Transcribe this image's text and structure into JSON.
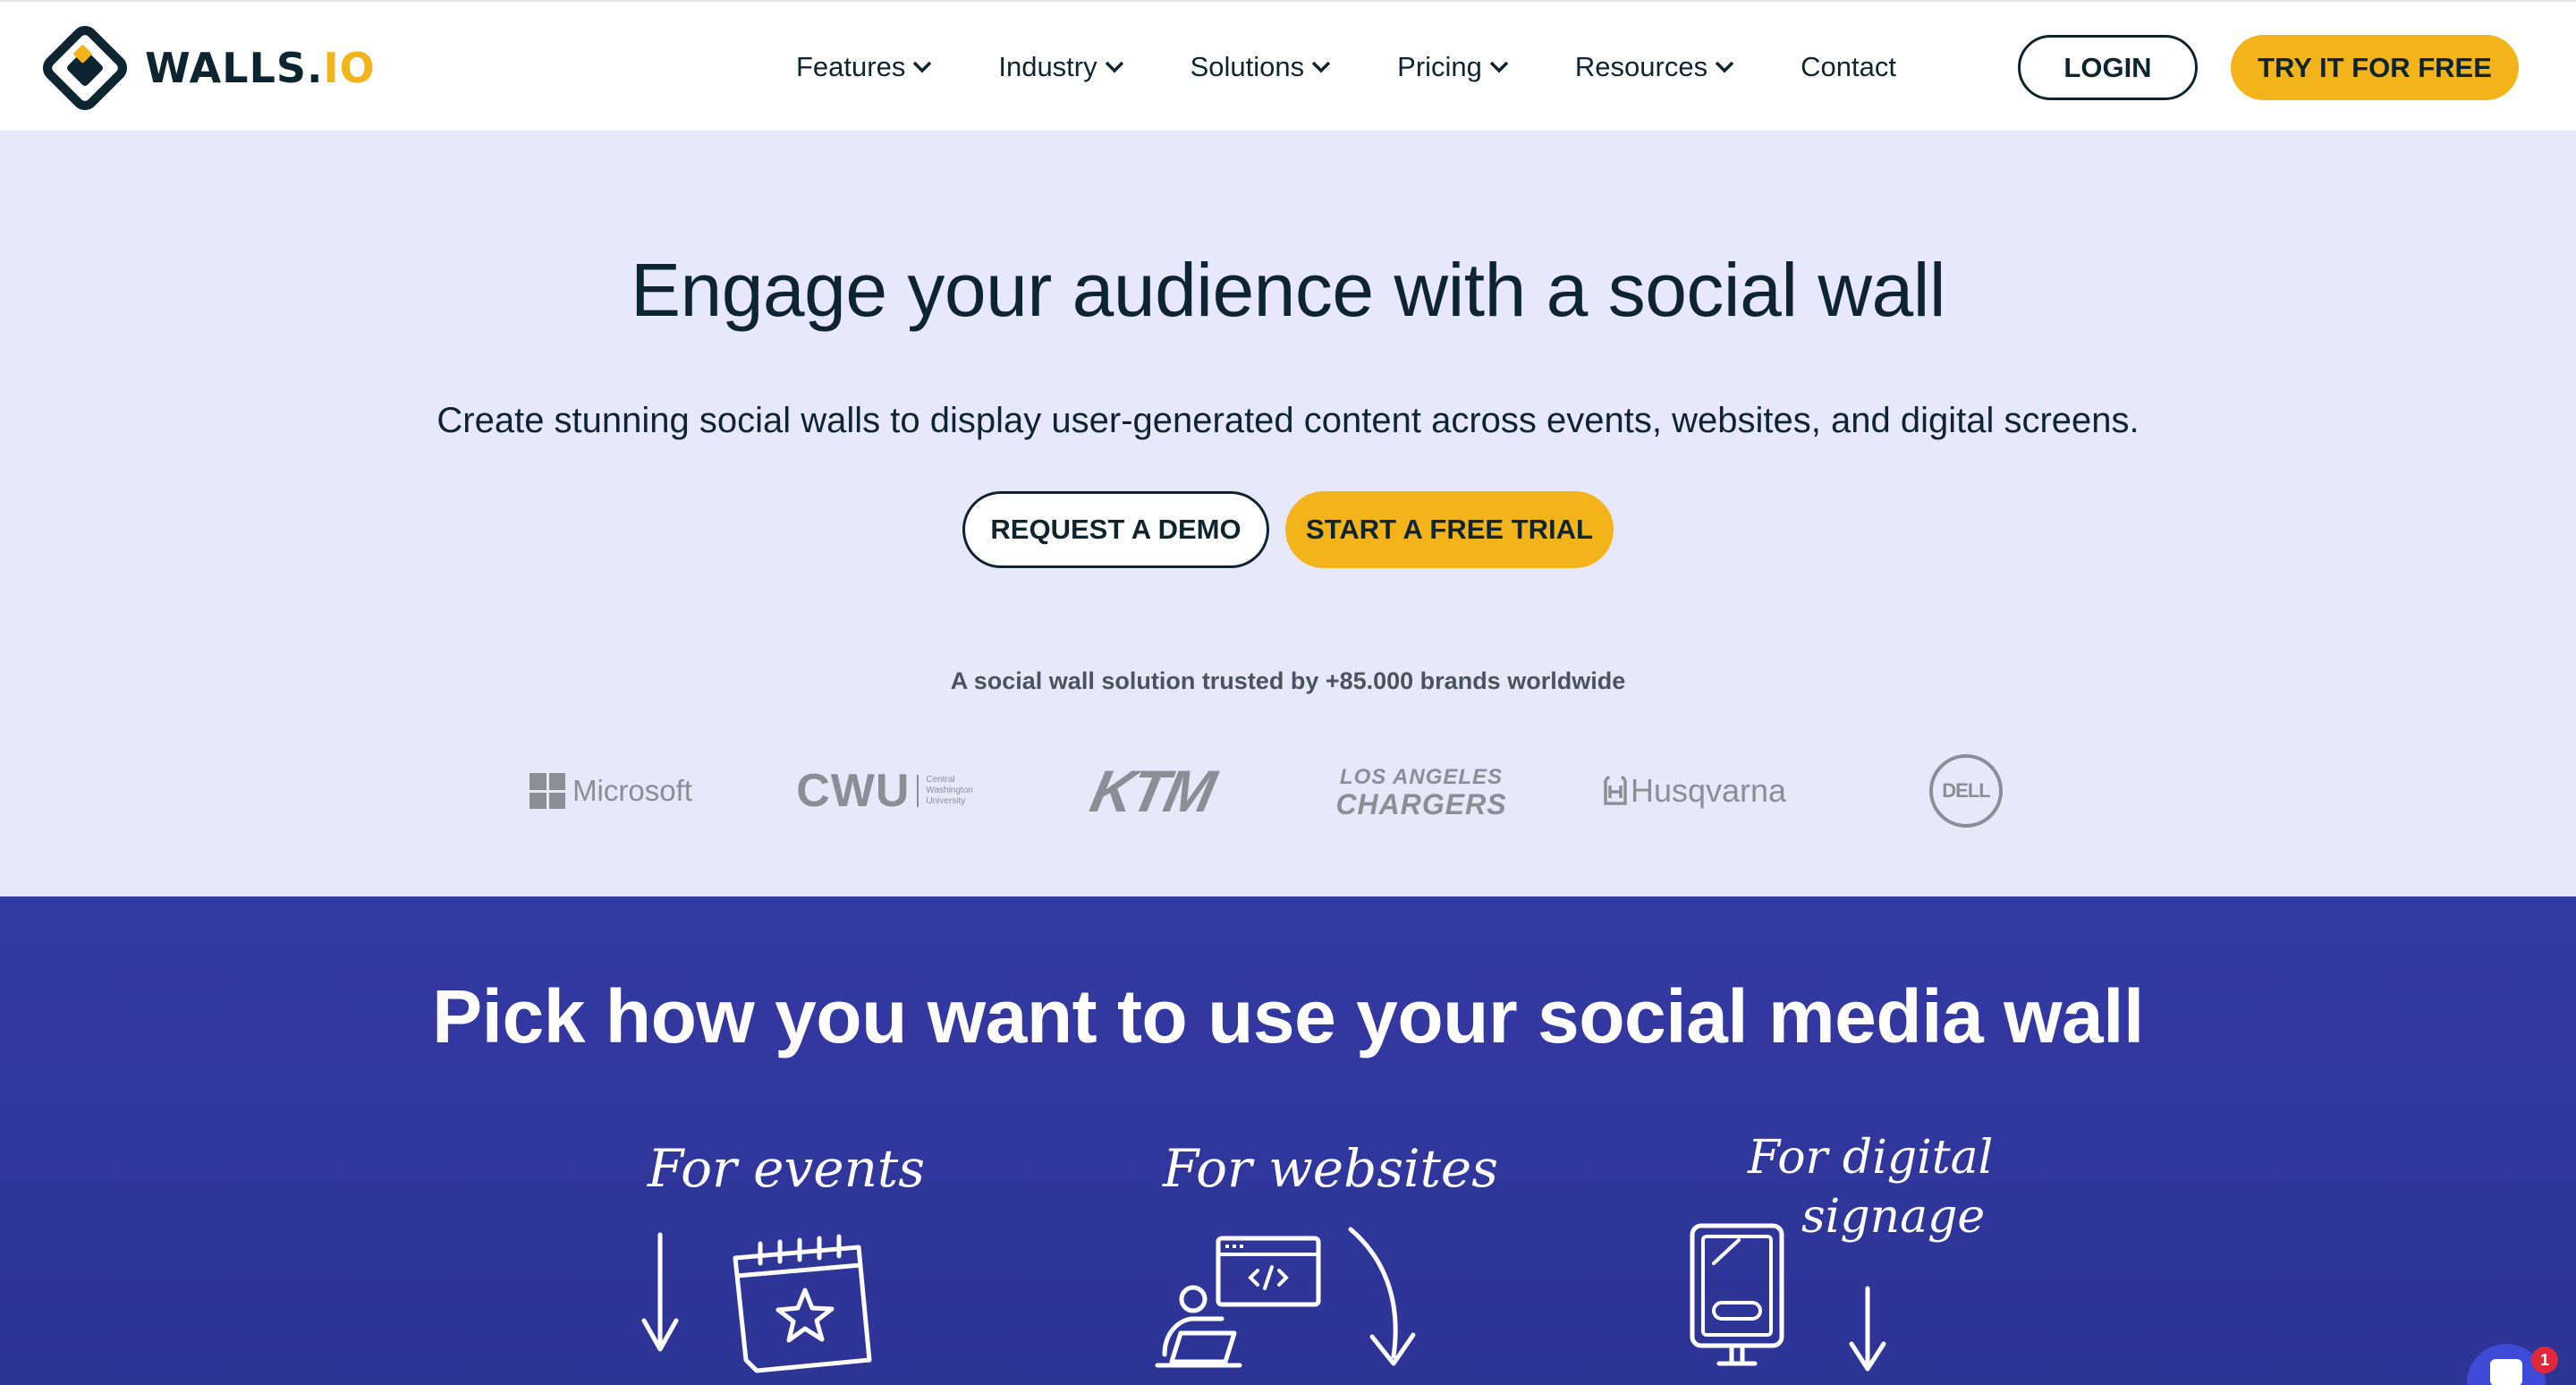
{
  "header": {
    "logo": {
      "text_main": "WALLS.",
      "text_accent": "IO"
    },
    "nav": [
      {
        "label": "Features",
        "has_dropdown": true
      },
      {
        "label": "Industry",
        "has_dropdown": true
      },
      {
        "label": "Solutions",
        "has_dropdown": true
      },
      {
        "label": "Pricing",
        "has_dropdown": true
      },
      {
        "label": "Resources",
        "has_dropdown": true
      },
      {
        "label": "Contact",
        "has_dropdown": false
      }
    ],
    "login_label": "LOGIN",
    "try_label": "TRY IT FOR FREE"
  },
  "hero": {
    "title": "Engage your audience with a social wall",
    "subtitle": "Create stunning social walls to display user-generated content across events, websites, and digital screens.",
    "demo_label": "REQUEST A DEMO",
    "trial_label": "START A FREE TRIAL",
    "trusted_text": "A social wall solution trusted by +85.000 brands worldwide",
    "brands": {
      "microsoft": "Microsoft",
      "cwu": "CWU",
      "cwu_sub": [
        "Central",
        "Washington",
        "University"
      ],
      "ktm": "KTM",
      "chargers_top": "LOS ANGELES",
      "chargers_bottom": "CHARGERS",
      "husqvarna": "Husqvarna",
      "dell": "DELL"
    }
  },
  "use_section": {
    "title": "Pick how you want to use your social media wall",
    "options": [
      {
        "label": "For events",
        "icon": "calendar-star-icon"
      },
      {
        "label": "For websites",
        "icon": "laptop-code-icon"
      },
      {
        "label_line1": "For digital",
        "label_line2": "signage",
        "icon": "digital-signage-icon"
      }
    ]
  },
  "chat": {
    "badge_count": "1"
  },
  "colors": {
    "accent_yellow": "#f3b41b",
    "navy_text": "#0d2530",
    "hero_bg": "#e8e8fb",
    "section_blue": "#343aa4",
    "chat_blue": "#3d4bd6",
    "badge_red": "#e0283a"
  }
}
